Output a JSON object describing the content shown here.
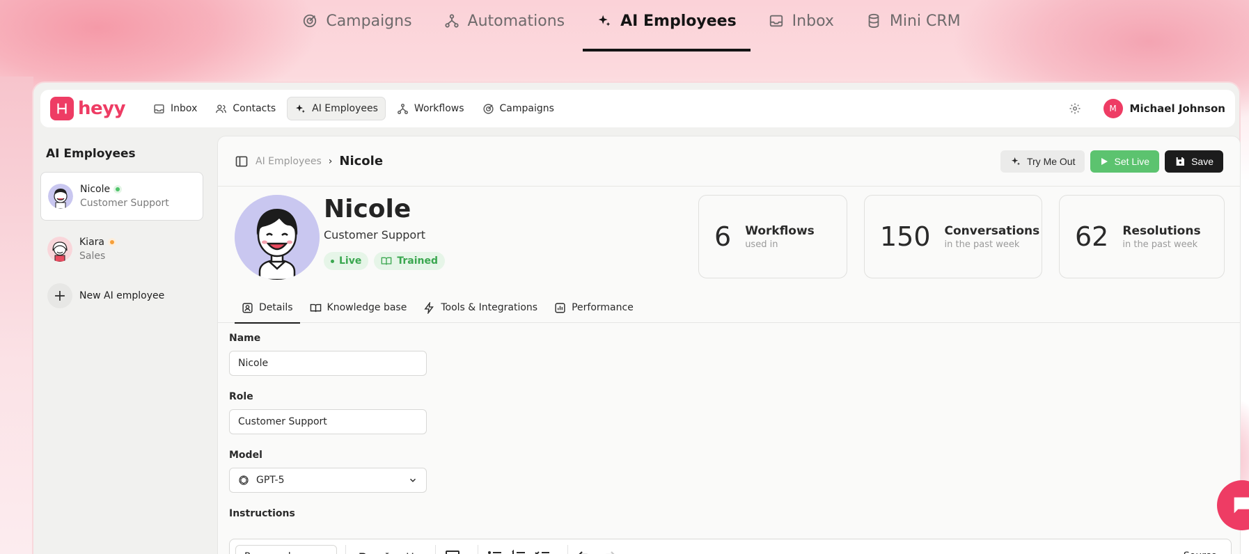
{
  "topnav": {
    "items": [
      {
        "label": "Campaigns",
        "icon": "target-icon"
      },
      {
        "label": "Automations",
        "icon": "flow-icon"
      },
      {
        "label": "AI Employees",
        "icon": "sparkle-icon",
        "active": true
      },
      {
        "label": "Inbox",
        "icon": "inbox-icon"
      },
      {
        "label": "Mini CRM",
        "icon": "database-icon"
      }
    ]
  },
  "app": {
    "logo": "heyy",
    "nav": [
      {
        "label": "Inbox"
      },
      {
        "label": "Contacts"
      },
      {
        "label": "AI Employees",
        "active": true
      },
      {
        "label": "Workflows"
      },
      {
        "label": "Campaigns"
      }
    ],
    "user": {
      "initial": "M",
      "name": "Michael Johnson"
    }
  },
  "sidebar": {
    "title": "AI Employees",
    "employees": [
      {
        "name": "Nicole",
        "role": "Customer Support",
        "status": "green"
      },
      {
        "name": "Kiara",
        "role": "Sales",
        "status": "orange"
      }
    ],
    "new_label": "New AI employee"
  },
  "main": {
    "breadcrumb": {
      "parent": "AI Employees",
      "separator": "›",
      "current": "Nicole"
    },
    "actions": {
      "try": "Try Me Out",
      "live": "Set Live",
      "save": "Save"
    },
    "profile": {
      "name": "Nicole",
      "role": "Customer Support",
      "badges": [
        "Live",
        "Trained"
      ]
    },
    "stats": [
      {
        "value": "6",
        "label": "Workflows",
        "sub": "used in"
      },
      {
        "value": "150",
        "label": "Conversations",
        "sub": "in the past week"
      },
      {
        "value": "62",
        "label": "Resolutions",
        "sub": "in the past week"
      }
    ],
    "tabs": [
      "Details",
      "Knowledge base",
      "Tools & Integrations",
      "Performance"
    ],
    "form": {
      "name_label": "Name",
      "name_value": "Nicole",
      "role_label": "Role",
      "role_value": "Customer Support",
      "model_label": "Model",
      "model_value": "GPT-5",
      "instructions_label": "Instructions"
    },
    "editor": {
      "block_type": "Paragraph",
      "source": "Source"
    }
  },
  "colors": {
    "brand": "#ee3c64",
    "green": "#5cc36f",
    "dark": "#1c1c1c"
  }
}
